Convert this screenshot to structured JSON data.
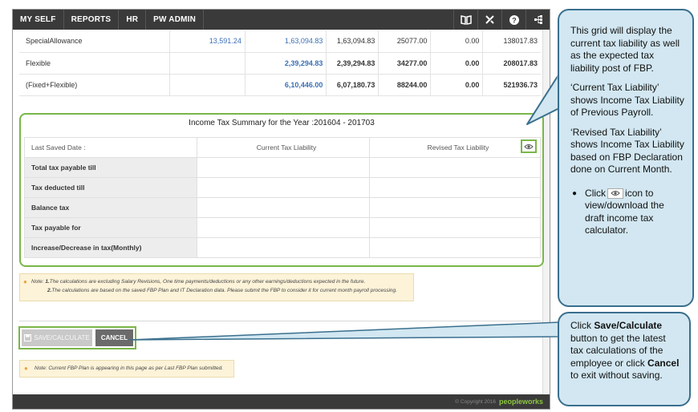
{
  "topbar": {
    "menu": [
      "MY SELF",
      "REPORTS",
      "HR",
      "PW ADMIN"
    ],
    "icons": [
      "book-icon",
      "tools-icon",
      "help-icon",
      "sitemap-icon"
    ]
  },
  "earnings": {
    "rows": [
      {
        "name": "SpecialAllowance",
        "c1": "13,591.24",
        "c2": "1,63,094.83",
        "c3": "1,63,094.83",
        "c4": "25077.00",
        "c5": "0.00",
        "c6": "138017.83"
      },
      {
        "name": "Flexible",
        "c1": "",
        "c2": "2,39,294.83",
        "c3": "2,39,294.83",
        "c4": "34277.00",
        "c5": "0.00",
        "c6": "208017.83"
      },
      {
        "name": "(Fixed+Flexible)",
        "c1": "",
        "c2": "6,10,446.00",
        "c3": "6,07,180.73",
        "c4": "88244.00",
        "c5": "0.00",
        "c6": "521936.73"
      }
    ]
  },
  "summary": {
    "title": "Income Tax Summary for the Year :201604 - 201703",
    "last_saved_label": "Last Saved Date :",
    "col_current": "Current Tax Liability",
    "col_revised": "Revised Tax Liability",
    "rows": [
      "Total tax payable till",
      "Tax deducted till",
      "Balance tax",
      "Tax payable for",
      "Increase/Decrease in tax(Monthly)"
    ]
  },
  "note": {
    "prefix": "Note:",
    "line1_num": "1.",
    "line1": "The calculations are excluding Salary Revisions, One time payments/deductions or any other earnings/deductions expected in the future.",
    "line2_num": "2.",
    "line2": "The calculations are based on the saved FBP Plan and IT Declaration data. Please submit the FBP to consider it for current month payroll processing."
  },
  "buttons": {
    "save": "SAVE/CALCULATE",
    "cancel": "CANCEL"
  },
  "note2": "Note: Current FBP Plan is appearing in this page as per Last FBP Plan submitted.",
  "footer": {
    "copyright": "© Copyright 2016",
    "brand": "peopleworks"
  },
  "callout1": {
    "p1": "This grid will display the current tax liability as well as the expected tax liability post of FBP.",
    "p2": "‘Current Tax Liability’ shows Income Tax Liability of Previous Payroll.",
    "p3": "‘Revised Tax Liability’ shows Income Tax Liability based on FBP Declaration done on Current Month.",
    "bullet_pre": "Click",
    "bullet_post": "icon to view/download the draft income tax calculator."
  },
  "callout2": {
    "t1": "Click ",
    "b1": "Save/Calculate",
    "t2": " button to get the latest tax calculations of the employee or click ",
    "b2": "Cancel",
    "t3": " to exit without saving."
  },
  "colors": {
    "accent_green": "#7ab648",
    "topbar": "#3a3a3a",
    "callout_bg": "#d2e7f1",
    "callout_border": "#3a6f8e"
  }
}
